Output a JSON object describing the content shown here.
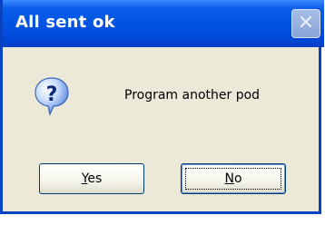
{
  "dialog": {
    "title": "All sent ok",
    "message": "Program another pod",
    "buttons": {
      "yes": {
        "label": "Yes",
        "mnemonic": "Y",
        "rest": "es"
      },
      "no": {
        "label": "No",
        "mnemonic": "N",
        "rest": "o"
      }
    },
    "icon": "question-icon",
    "close_icon": "close-icon"
  },
  "colors": {
    "titlebar": "#0254e0",
    "dialog_bg": "#ece9d8",
    "close_button": "#8aa4d8"
  }
}
